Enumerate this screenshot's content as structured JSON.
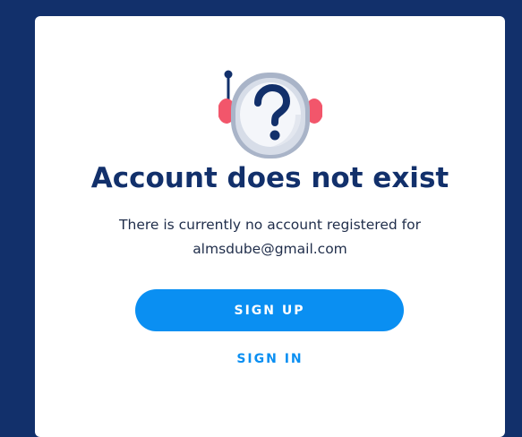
{
  "dialog": {
    "title": "Account does not exist",
    "message_line1": "There is currently no account registered for",
    "message_line2": "almsdube@gmail.com",
    "signup_label": "SIGN UP",
    "signin_label": "SIGN IN",
    "illustration_icon": "astronaut-helmet-question-icon"
  },
  "colors": {
    "background": "#12306b",
    "card": "#ffffff",
    "title": "#12306b",
    "accent": "#0a8ff2",
    "helmet_ear": "#f2566b"
  }
}
